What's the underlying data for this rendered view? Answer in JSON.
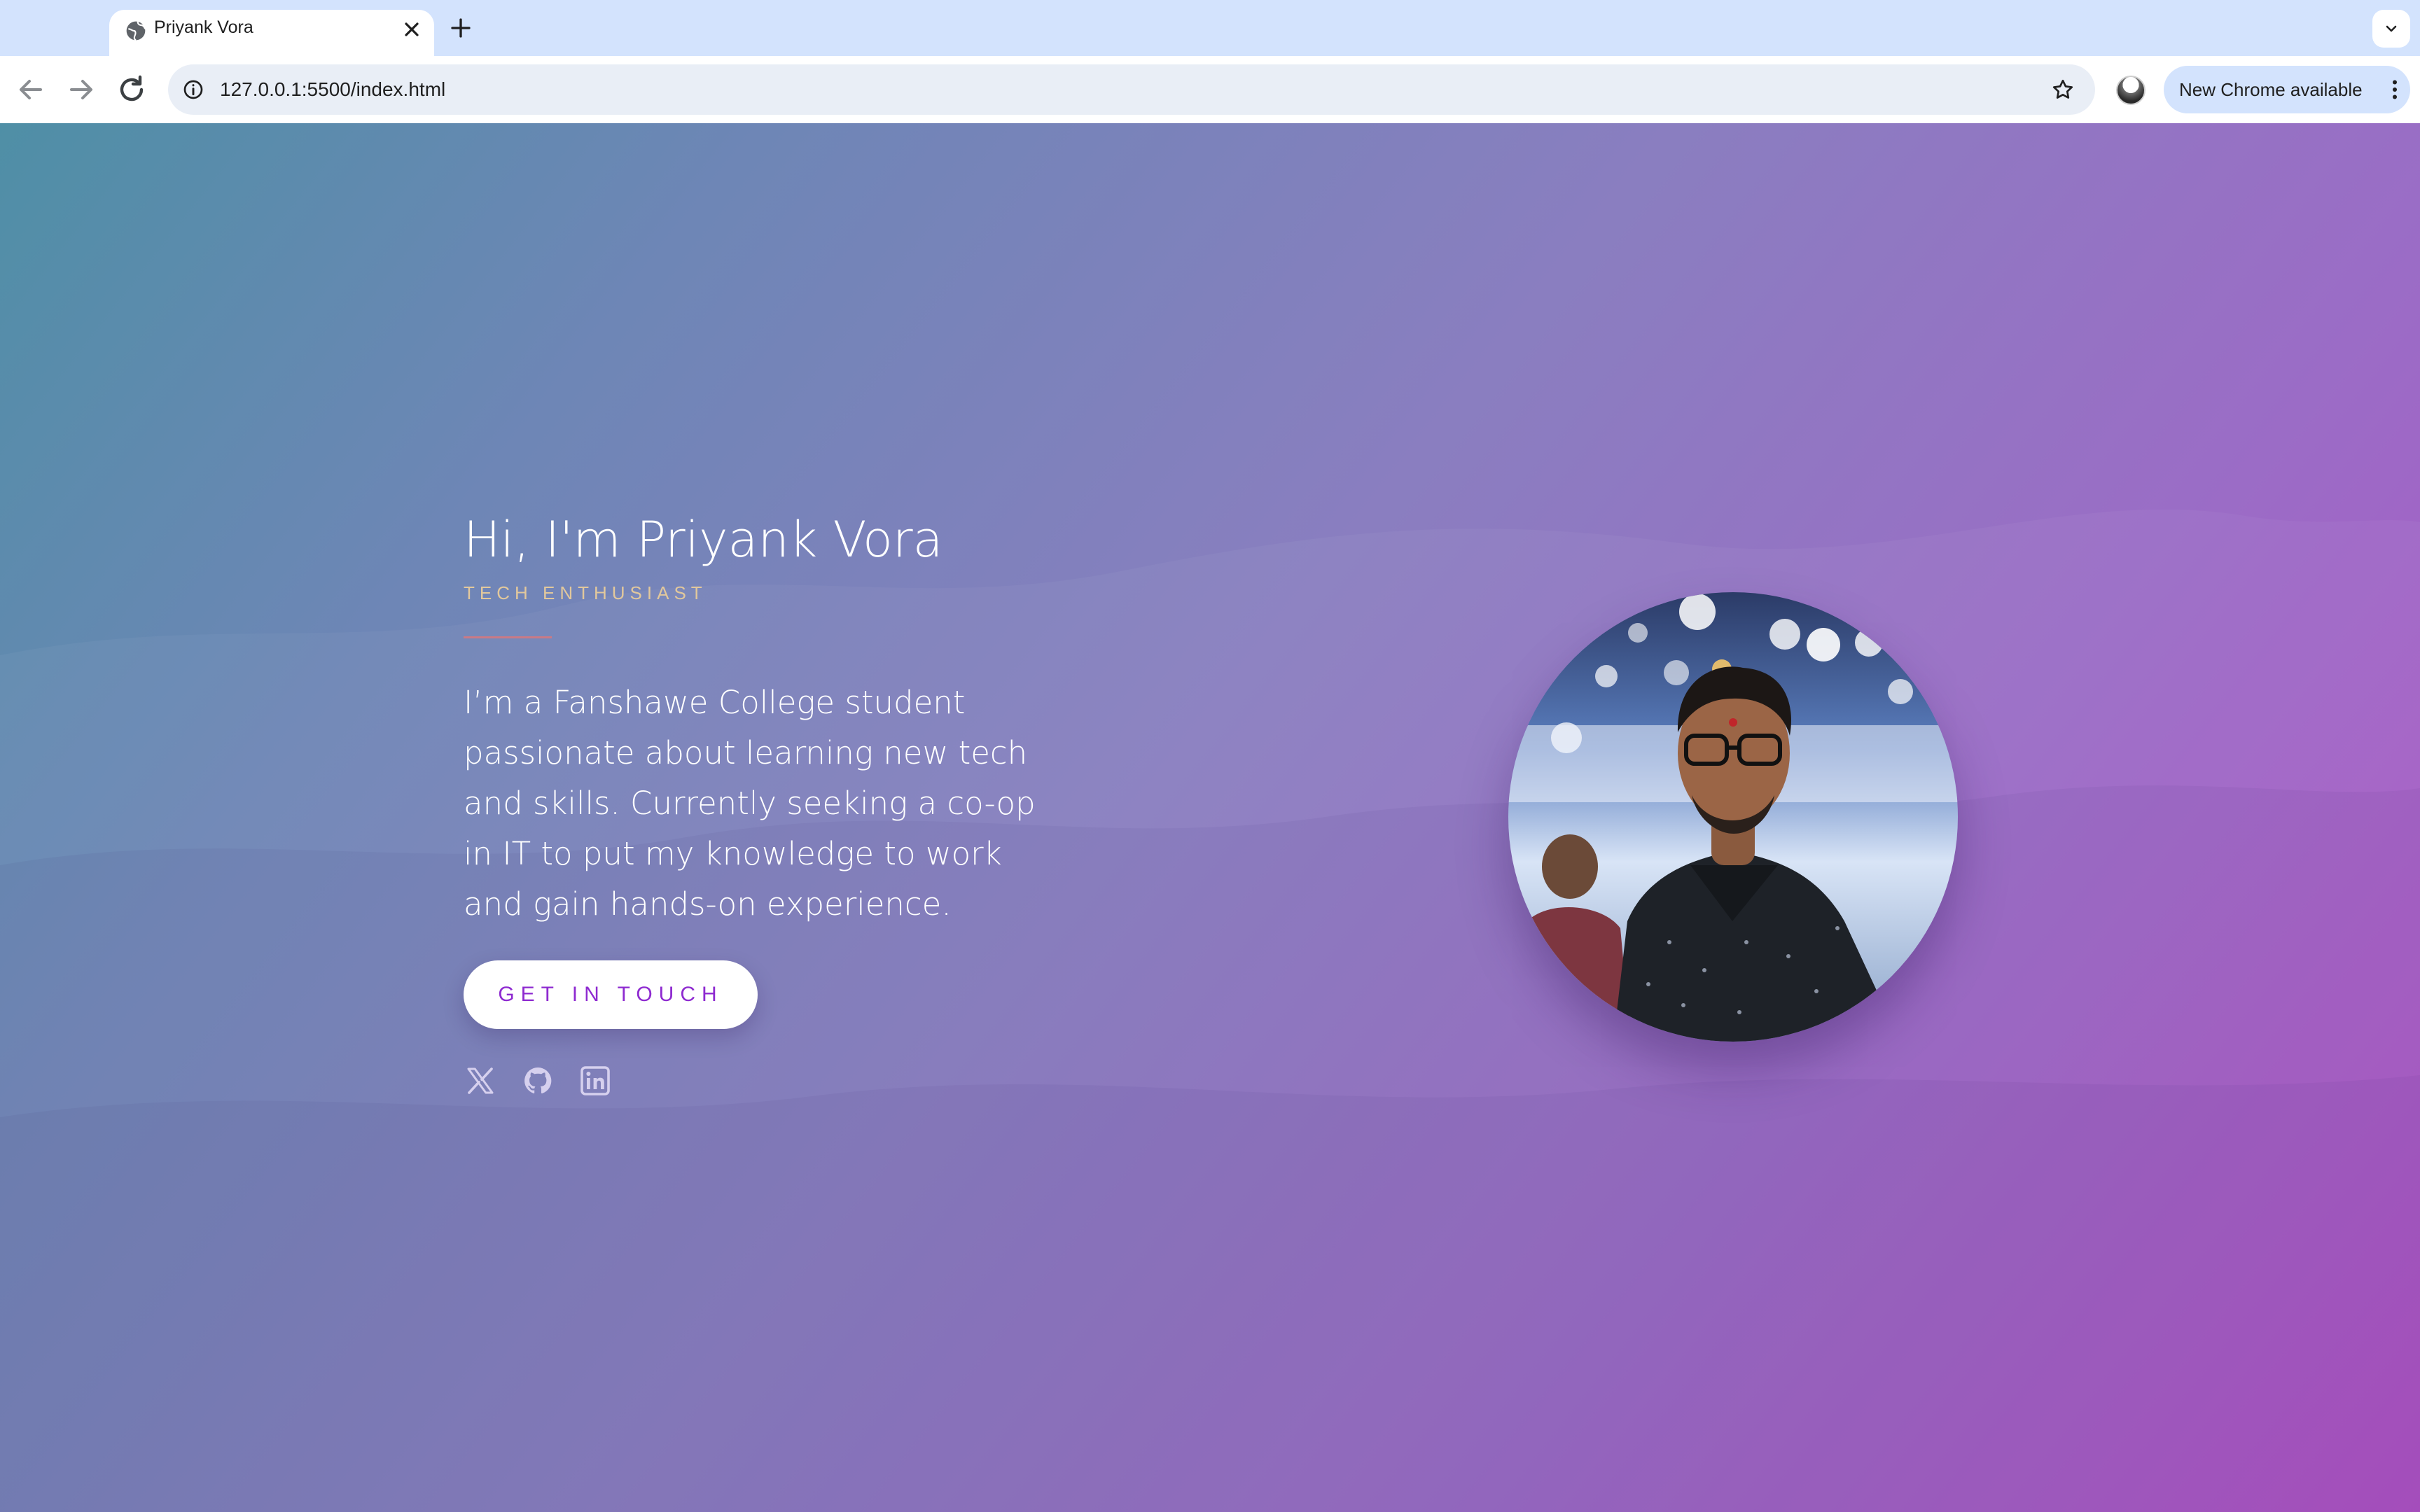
{
  "browser": {
    "tab_title": "Priyank Vora",
    "url": "127.0.0.1:5500/index.html",
    "update_label": "New Chrome available"
  },
  "hero": {
    "title": "Hi, I'm Priyank Vora",
    "subtitle": "TECH ENTHUSIAST",
    "paragraph": "I’m a Fanshawe College student passionate about learning new tech and skills. Currently seeking a co-op in IT to put my knowledge to work and gain hands-on experience.",
    "cta_label": "GET IN TOUCH"
  },
  "socials": [
    {
      "icon": "x-twitter-icon"
    },
    {
      "icon": "github-icon"
    },
    {
      "icon": "linkedin-icon"
    }
  ],
  "colors": {
    "cta_text": "#8e2ad0",
    "subtitle": "#e2c89c",
    "divider": "#c97a86",
    "gradient_start": "#4f8fa6",
    "gradient_end": "#b04fc4"
  }
}
